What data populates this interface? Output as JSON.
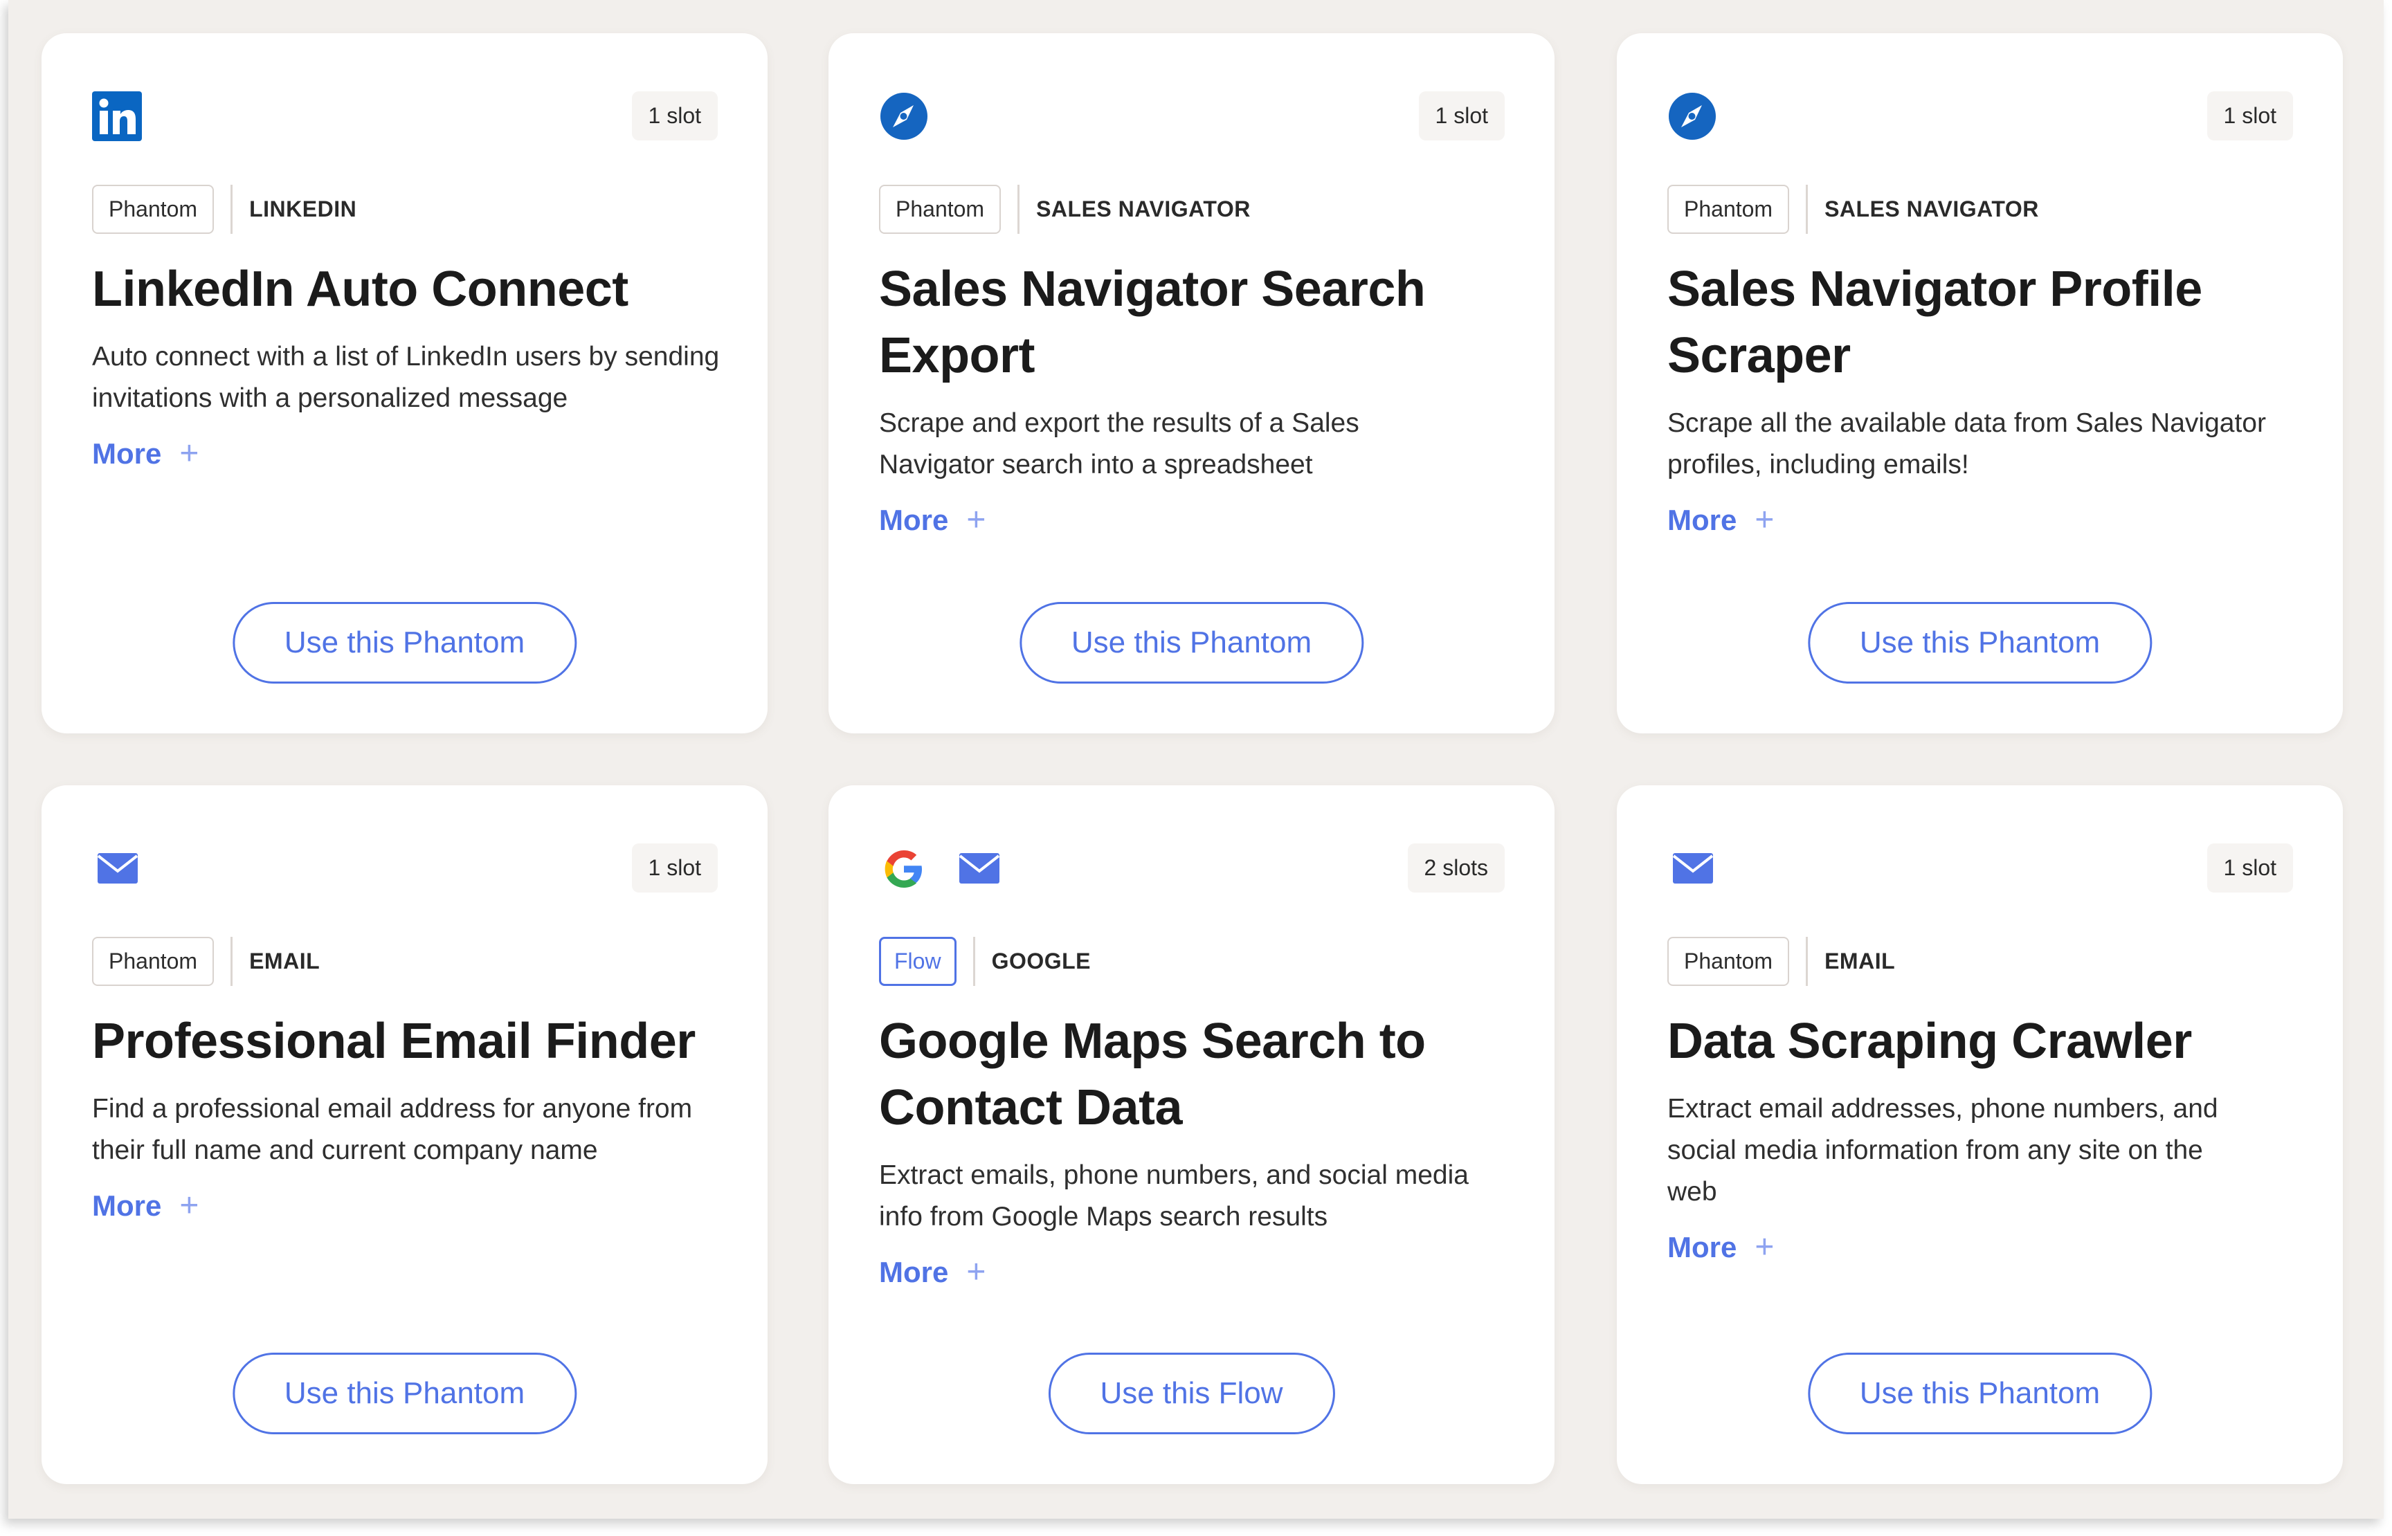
{
  "colors": {
    "accent": "#5073e5",
    "linkedin_blue": "#0a66c2",
    "frame_bg": "#f2efec",
    "card_bg": "#ffffff"
  },
  "cards": [
    {
      "icons": [
        "linkedin-icon"
      ],
      "slots": "1 slot",
      "type": "Phantom",
      "category": "LINKEDIN",
      "title": "LinkedIn Auto Connect",
      "description": "Auto connect with a list of LinkedIn users by sending invitations with a personalized message",
      "more_label": "More",
      "more_icon": "plus-icon",
      "button_label": "Use this Phantom"
    },
    {
      "icons": [
        "compass-icon"
      ],
      "slots": "1 slot",
      "type": "Phantom",
      "category": "SALES NAVIGATOR",
      "title": "Sales Navigator Search Export",
      "description": "Scrape and export the results of a Sales Navigator search into a spreadsheet",
      "more_label": "More",
      "more_icon": "plus-icon",
      "button_label": "Use this Phantom"
    },
    {
      "icons": [
        "compass-icon"
      ],
      "slots": "1 slot",
      "type": "Phantom",
      "category": "SALES NAVIGATOR",
      "title": "Sales Navigator Profile Scraper",
      "description": "Scrape all the available data from Sales Navigator profiles, including emails!",
      "more_label": "More",
      "more_icon": "plus-icon",
      "button_label": "Use this Phantom"
    },
    {
      "icons": [
        "envelope-icon"
      ],
      "slots": "1 slot",
      "type": "Phantom",
      "category": "EMAIL",
      "title": "Professional Email Finder",
      "description": "Find a professional email address for anyone from their full name and current company name",
      "more_label": "More",
      "more_icon": "plus-icon",
      "button_label": "Use this Phantom"
    },
    {
      "icons": [
        "google-icon",
        "envelope-icon"
      ],
      "slots": "2 slots",
      "type": "Flow",
      "category": "GOOGLE",
      "title": "Google Maps Search to Contact Data",
      "description": "Extract emails, phone numbers, and social media info from Google Maps search results",
      "more_label": "More",
      "more_icon": "plus-icon",
      "button_label": "Use this Flow"
    },
    {
      "icons": [
        "envelope-icon"
      ],
      "slots": "1 slot",
      "type": "Phantom",
      "category": "EMAIL",
      "title": "Data Scraping Crawler",
      "description": "Extract email addresses, phone numbers, and social media information from any site on the web",
      "more_label": "More",
      "more_icon": "plus-icon",
      "button_label": "Use this Phantom"
    }
  ]
}
